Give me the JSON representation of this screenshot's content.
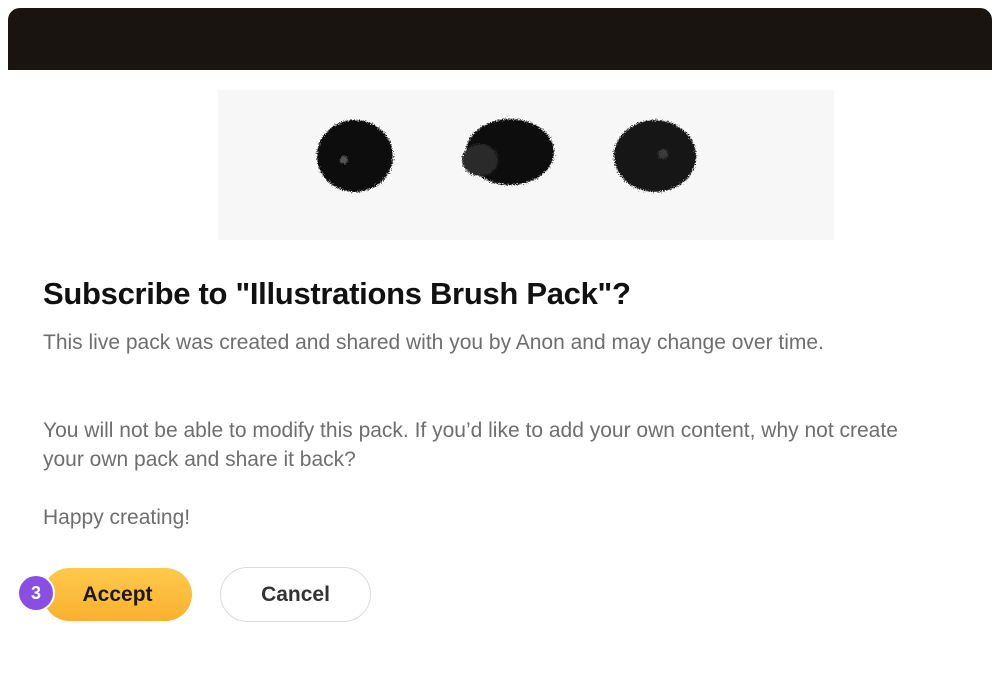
{
  "dialog": {
    "title": "Subscribe to \"Illustrations Brush Pack\"?",
    "paragraphs": [
      "This live pack was created and shared with you by Anon and may change over time.",
      "You will not be able to modify this pack. If you’d like to add your own content, why not create your own pack and share it back?",
      "Happy creating!"
    ],
    "buttons": {
      "accept_label": "Accept",
      "cancel_label": "Cancel"
    },
    "step_badge": "3"
  },
  "preview": {
    "icons": [
      "brush-stroke-round-icon",
      "brush-stroke-blot-icon",
      "brush-stroke-textured-icon"
    ]
  },
  "colors": {
    "header": "#1a1410",
    "accent": "#f9b12e",
    "badge": "#8a4fe0"
  }
}
